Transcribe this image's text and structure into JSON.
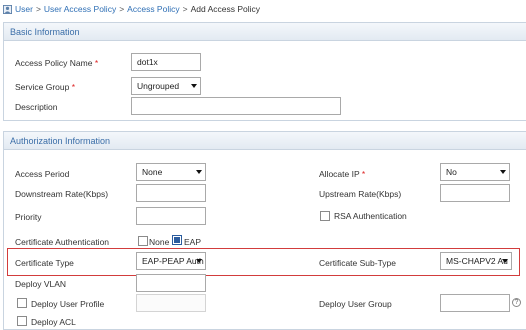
{
  "breadcrumb": [
    "User",
    "User Access Policy",
    "Access Policy",
    "Add Access Policy"
  ],
  "basic": {
    "section_title": "Basic Information",
    "policy_name_label": "Access Policy Name",
    "policy_name_value": "dot1x",
    "service_group_label": "Service Group",
    "service_group_value": "Ungrouped",
    "description_label": "Description",
    "description_value": "",
    "required_mark": "*"
  },
  "auth": {
    "section_title": "Authorization Information",
    "access_period_label": "Access Period",
    "access_period_value": "None",
    "allocate_ip_label": "Allocate IP",
    "allocate_ip_value": "No",
    "downstream_label": "Downstream Rate(Kbps)",
    "downstream_value": "",
    "upstream_label": "Upstream Rate(Kbps)",
    "upstream_value": "",
    "priority_label": "Priority",
    "priority_value": "",
    "rsa_label": "RSA Authentication",
    "rsa_checked": false,
    "cert_auth_label": "Certificate Authentication",
    "cert_none_label": "None",
    "cert_eap_label": "EAP",
    "cert_none_checked": false,
    "cert_eap_checked": true,
    "cert_type_label": "Certificate Type",
    "cert_type_value": "EAP-PEAP Auth",
    "cert_subtype_label": "Certificate Sub-Type",
    "cert_subtype_value": "MS-CHAPV2 Au",
    "deploy_vlan_label": "Deploy VLAN",
    "deploy_vlan_value": "",
    "deploy_profile_label": "Deploy User Profile",
    "deploy_profile_value": "",
    "deploy_group_label": "Deploy User Group",
    "deploy_group_value": "",
    "deploy_acl_label": "Deploy ACL",
    "help_glyph": "?"
  },
  "colors": {
    "link": "#2f6fb5",
    "section_title": "#3b6ea8",
    "highlight_border": "#d23c3c",
    "required": "#dd2222"
  }
}
